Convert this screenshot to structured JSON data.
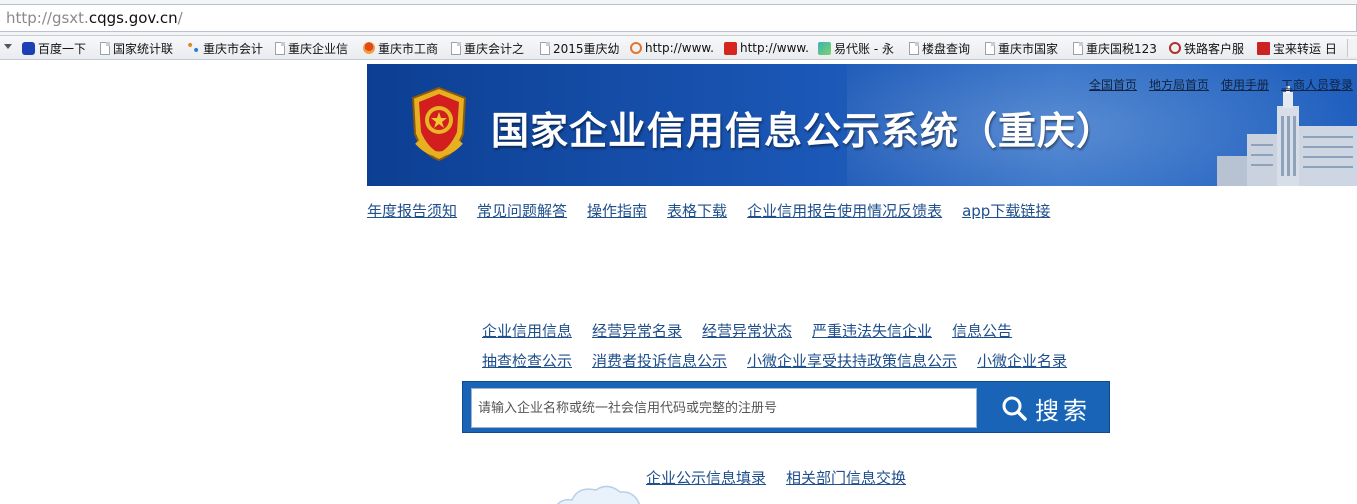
{
  "browser": {
    "url_prefix": "http://gsxt.",
    "url_domain": "cqgs.gov.cn",
    "url_suffix": "/",
    "bookmarks": [
      {
        "label": "百度一下",
        "icon": "baidu-paw-icon"
      },
      {
        "label": "国家统计联",
        "icon": "page-icon"
      },
      {
        "label": "重庆市会计",
        "icon": "colorful-dots-icon"
      },
      {
        "label": "重庆企业信",
        "icon": "page-icon"
      },
      {
        "label": "重庆市工商",
        "icon": "red-pin-icon"
      },
      {
        "label": "重庆会计之",
        "icon": "page-icon"
      },
      {
        "label": "2015重庆幼",
        "icon": "page-icon"
      },
      {
        "label": "http://www.",
        "icon": "weibo-icon"
      },
      {
        "label": "http://www.",
        "icon": "red-square-icon"
      },
      {
        "label": "易代账 - 永",
        "icon": "teal-logo-icon"
      },
      {
        "label": "楼盘查询",
        "icon": "page-icon"
      },
      {
        "label": "重庆市国家",
        "icon": "page-icon"
      },
      {
        "label": "重庆国税123",
        "icon": "page-icon"
      },
      {
        "label": "铁路客户服",
        "icon": "railway-icon"
      },
      {
        "label": "宝来转运 日",
        "icon": "baolai-icon"
      }
    ]
  },
  "header": {
    "title": "国家企业信用信息公示系统（重庆）",
    "top_links": [
      "全国首页",
      "地方局首页",
      "使用手册",
      "工商人员登录"
    ]
  },
  "nav": [
    "年度报告须知",
    "常见问题解答",
    "操作指南",
    "表格下载",
    "企业信用报告使用情况反馈表",
    "app下载链接"
  ],
  "categories_row1": [
    "企业信用信息",
    "经营异常名录",
    "经营异常状态",
    "严重违法失信企业",
    "信息公告"
  ],
  "categories_row2": [
    "抽查检查公示",
    "消费者投诉信息公示",
    "小微企业享受扶持政策信息公示",
    "小微企业名录"
  ],
  "search": {
    "placeholder": "请输入企业名称或统一社会信用代码或完整的注册号",
    "button_label": "搜索"
  },
  "bottom_links": [
    "企业公示信息填录",
    "相关部门信息交换"
  ],
  "colors": {
    "banner_blue": "#1b57b6",
    "search_blue": "#1a64b8",
    "link_blue": "#1f4f8c"
  }
}
